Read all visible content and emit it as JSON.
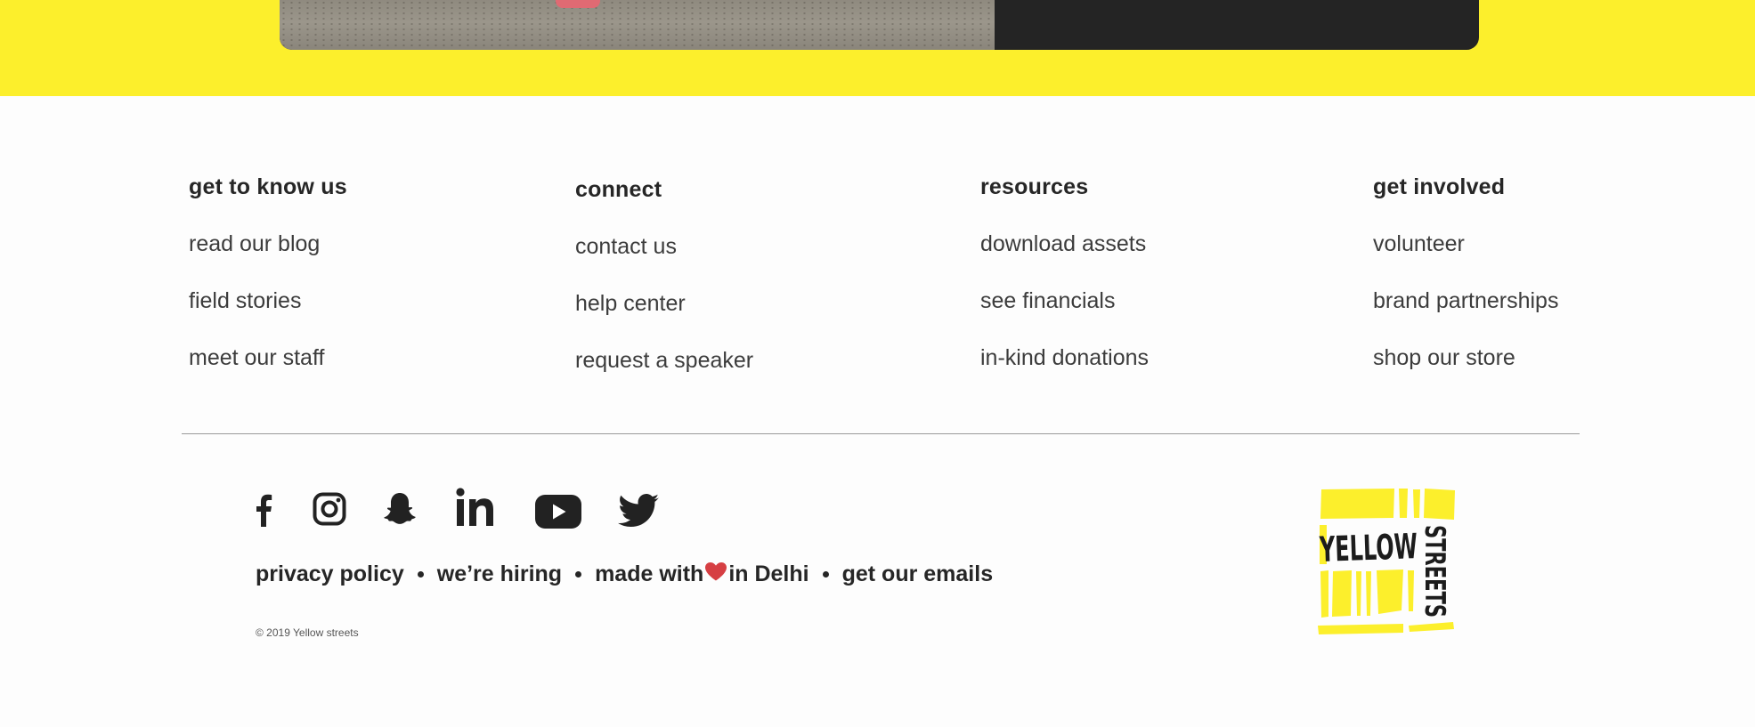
{
  "colors": {
    "brand_yellow": "#fcef2c",
    "text_dark": "#262626",
    "heart": "#d63f43"
  },
  "hero": {
    "image": "beach-photo"
  },
  "footer": {
    "columns": [
      {
        "heading": "get to know us",
        "links": [
          "read our blog",
          "field stories",
          "meet our staff"
        ]
      },
      {
        "heading": "connect",
        "links": [
          "contact us",
          "help center",
          "request a speaker"
        ]
      },
      {
        "heading": "resources",
        "links": [
          "download assets",
          "see financials",
          "in-kind donations"
        ]
      },
      {
        "heading": "get involved",
        "links": [
          "volunteer",
          "brand partnerships",
          "shop our store"
        ]
      }
    ],
    "socials": [
      "facebook-icon",
      "instagram-icon",
      "snapchat-icon",
      "linkedin-icon",
      "youtube-icon",
      "twitter-icon"
    ],
    "legal": {
      "privacy": "privacy policy",
      "hiring": "we’re hiring",
      "made_with": "made with",
      "in_city": "in Delhi",
      "emails": "get our emails"
    },
    "copyright": "© 2019 Yellow streets",
    "logo": {
      "line1": "YELLOW",
      "line2": "STREETS"
    }
  }
}
